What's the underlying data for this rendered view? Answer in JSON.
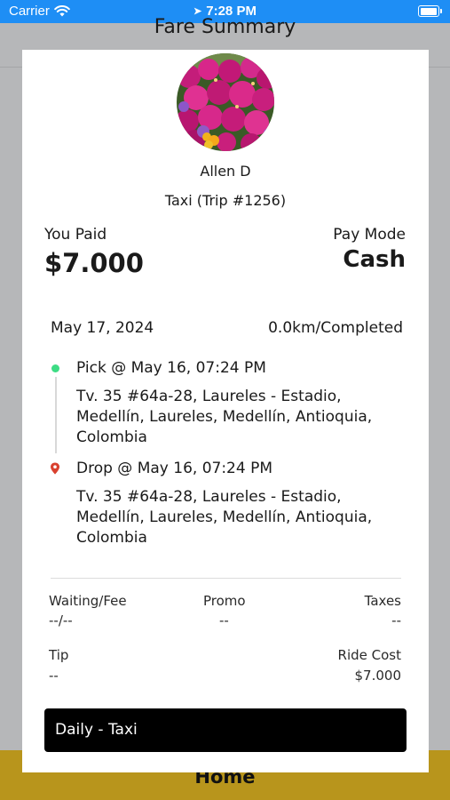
{
  "status_bar": {
    "carrier": "Carrier",
    "time": "7:28 PM"
  },
  "background": {
    "title": "Fare Summary",
    "footer_label": "Home"
  },
  "driver": {
    "name": "Allen D",
    "trip": "Taxi (Trip #1256)"
  },
  "payment": {
    "paid_label": "You Paid",
    "amount": "$7.000",
    "mode_label": "Pay Mode",
    "mode": "Cash"
  },
  "trip_info": {
    "date": "May 17, 2024",
    "distance_status": "0.0km/Completed"
  },
  "pickup": {
    "title": "Pick @ May 16, 07:24 PM",
    "address": "Tv. 35 #64a-28, Laureles - Estadio, Medellín, Laureles, Medellín, Antioquia, Colombia"
  },
  "dropoff": {
    "title": "Drop @ May 16, 07:24 PM",
    "address": "Tv. 35 #64a-28, Laureles - Estadio, Medellín, Laureles, Medellín, Antioquia, Colombia"
  },
  "fare": {
    "waiting_label": "Waiting/Fee",
    "waiting_value": "--/--",
    "promo_label": "Promo",
    "promo_value": "--",
    "taxes_label": "Taxes",
    "taxes_value": "--",
    "tip_label": "Tip",
    "tip_value": "--",
    "ride_cost_label": "Ride Cost",
    "ride_cost_value": "$7.000"
  },
  "plan": {
    "label": "Daily - Taxi"
  },
  "colors": {
    "status_bar": "#1e8ef5",
    "pickup_dot": "#3ddc84",
    "drop_pin": "#d9412f",
    "footer": "#b8951c"
  },
  "icons": {
    "wifi": "wifi-icon",
    "location": "location-arrow-icon",
    "battery": "battery-icon",
    "pickup": "pickup-dot-icon",
    "drop": "drop-pin-icon"
  }
}
